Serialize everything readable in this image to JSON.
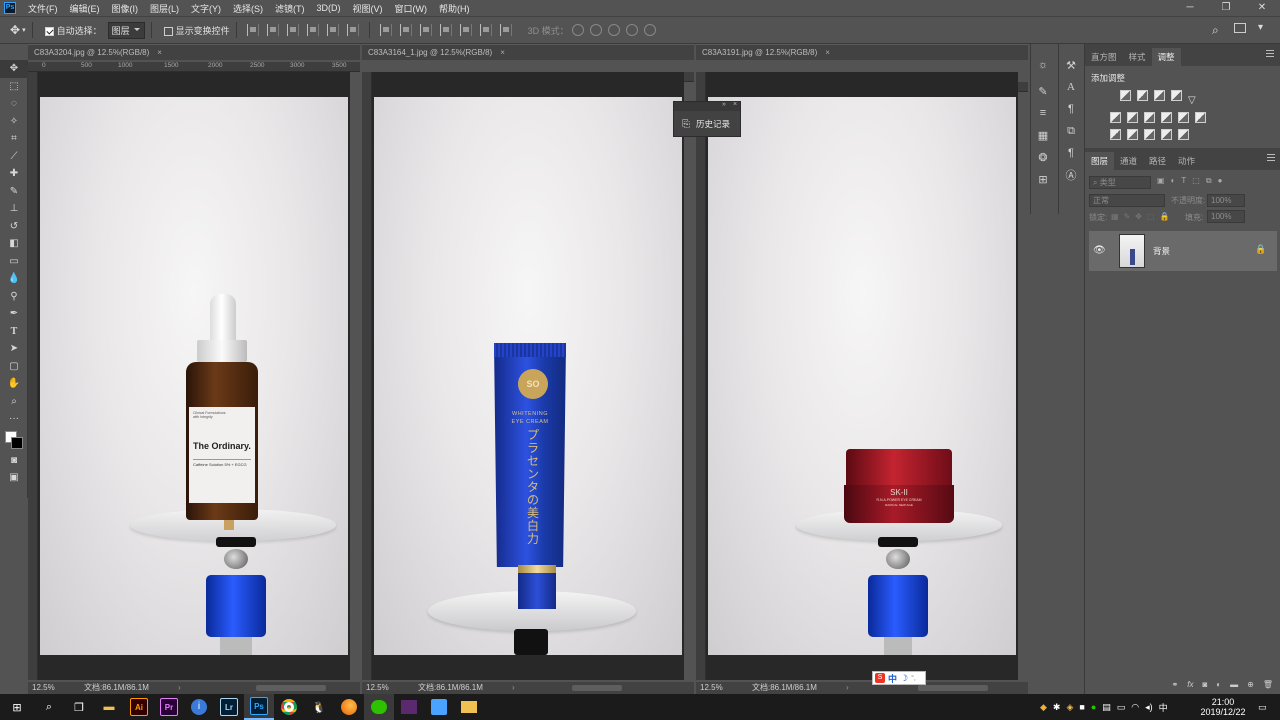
{
  "menubar": {
    "logo": "Ps",
    "items": [
      "文件(F)",
      "编辑(E)",
      "图像(I)",
      "图层(L)",
      "文字(Y)",
      "选择(S)",
      "滤镜(T)",
      "3D(D)",
      "视图(V)",
      "窗口(W)",
      "帮助(H)"
    ]
  },
  "options": {
    "auto_select_label": "自动选择：",
    "auto_select_value": "图层",
    "show_transform_label": "显示变换控件",
    "mode_3d_label": "3D 模式："
  },
  "documents": [
    {
      "tab": "C83A3204.jpg @ 12.5%(RGB/8)",
      "zoom": "12.5%",
      "doc_size": "文档:86.1M/86.1M",
      "ruler": [
        "0",
        "500",
        "1000",
        "1500",
        "2000",
        "2500",
        "3000",
        "3500"
      ]
    },
    {
      "tab": "C83A3164_1.jpg @ 12.5%(RGB/8)",
      "zoom": "12.5%",
      "doc_size": "文档:86.1M/86.1M"
    },
    {
      "tab": "C83A3191.jpg @ 12.5%(RGB/8)",
      "zoom": "12.5%",
      "doc_size": "文档:86.1M/86.1M"
    }
  ],
  "products": {
    "bottle_brand": "The Ordinary.",
    "bottle_small": "Clinical Formulations with Integrity",
    "bottle_name": "Caffeine Solution 5% + EGCG",
    "tube_line1": "WHITENING",
    "tube_line2": "EYE CREAM",
    "tube_vertical": "プラセンタの美白力",
    "tube_logo": "SO",
    "jar_brand": "SK-II",
    "jar_line1": "R.N.A.POWER EYE CREAM",
    "jar_line2": "RADICAL NEW AGE"
  },
  "history_panel": {
    "title": "历史记录"
  },
  "panels": {
    "top_tabs": [
      "直方图",
      "样式",
      "调整"
    ],
    "active_top": "调整",
    "add_adjustment": "添加调整",
    "layer_tabs": [
      "图层",
      "通道",
      "路径",
      "动作"
    ],
    "filter_placeholder": "类型",
    "blend_mode": "正常",
    "opacity_label": "不透明度:",
    "opacity_value": "100%",
    "lock_label": "锁定:",
    "fill_label": "填充:",
    "fill_value": "100%",
    "layer_name": "背景",
    "footer_icons": "fx"
  },
  "ime": {
    "label": "中"
  },
  "taskbar": {
    "apps": [
      {
        "label": "Ai",
        "color": "#ff9a00",
        "bg": "#330000"
      },
      {
        "label": "Pr",
        "color": "#e77cff",
        "bg": "#2a0038"
      },
      {
        "label": "Lr",
        "color": "#add5ec",
        "bg": "#001e36"
      },
      {
        "label": "Ps",
        "color": "#31a8ff",
        "bg": "#001e36"
      }
    ],
    "tray_lang": "中",
    "time": "21:00",
    "date": "2019/12/22"
  },
  "colors": {
    "ps_bg": "#535353",
    "accent": "#31a8ff",
    "tube_blue": "#1e3db3",
    "jar_red": "#9b1522"
  }
}
